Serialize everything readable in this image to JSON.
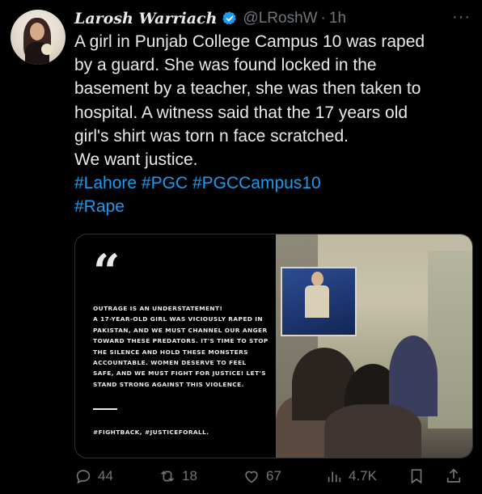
{
  "author": {
    "display_name": "Larosh Warriach",
    "handle": "@LRoshW",
    "separator": "·",
    "time": "1h"
  },
  "tweet": {
    "lines": [
      "A girl in Punjab College Campus 10 was raped",
      "by a guard. She was found locked in the",
      "basement by a teacher, she was then taken to",
      "hospital. A witness said that the 17 years old",
      "girl's shirt was torn n face  scratched.",
      "We want justice."
    ],
    "hashtags": [
      "#Lahore",
      "#PGC",
      "#PGCCampus10",
      "#Rape"
    ]
  },
  "media": {
    "quote_mark": "“",
    "quote_lines": [
      "OUTRAGE IS AN UNDERSTATEMENT!",
      "A 17-YEAR-OLD GIRL WAS VICIOUSLY RAPED IN",
      "PAKISTAN, AND WE MUST CHANNEL OUR ANGER",
      "TOWARD THESE PREDATORS. IT'S TIME TO STOP",
      "THE SILENCE AND HOLD THESE MONSTERS",
      "ACCOUNTABLE. WOMEN DESERVE TO FEEL",
      "SAFE, AND WE MUST FIGHT FOR JUSTICE! LET'S",
      "STAND STRONG AGAINST THIS VIOLENCE."
    ],
    "tags": "#FIGHTBACK, #JUSTICEFORALL."
  },
  "actions": {
    "reply_count": "44",
    "retweet_count": "18",
    "like_count": "67",
    "views_count": "4.7K"
  },
  "menu": {
    "more_label": "···"
  },
  "colors": {
    "background": "#000000",
    "text": "#e7e9ea",
    "muted": "#71767b",
    "link": "#1d9bf0",
    "verified": "#1d9bf0"
  },
  "icons": [
    "verified-badge-icon",
    "more-icon",
    "reply-icon",
    "retweet-icon",
    "like-icon",
    "views-icon",
    "bookmark-icon",
    "share-icon"
  ]
}
